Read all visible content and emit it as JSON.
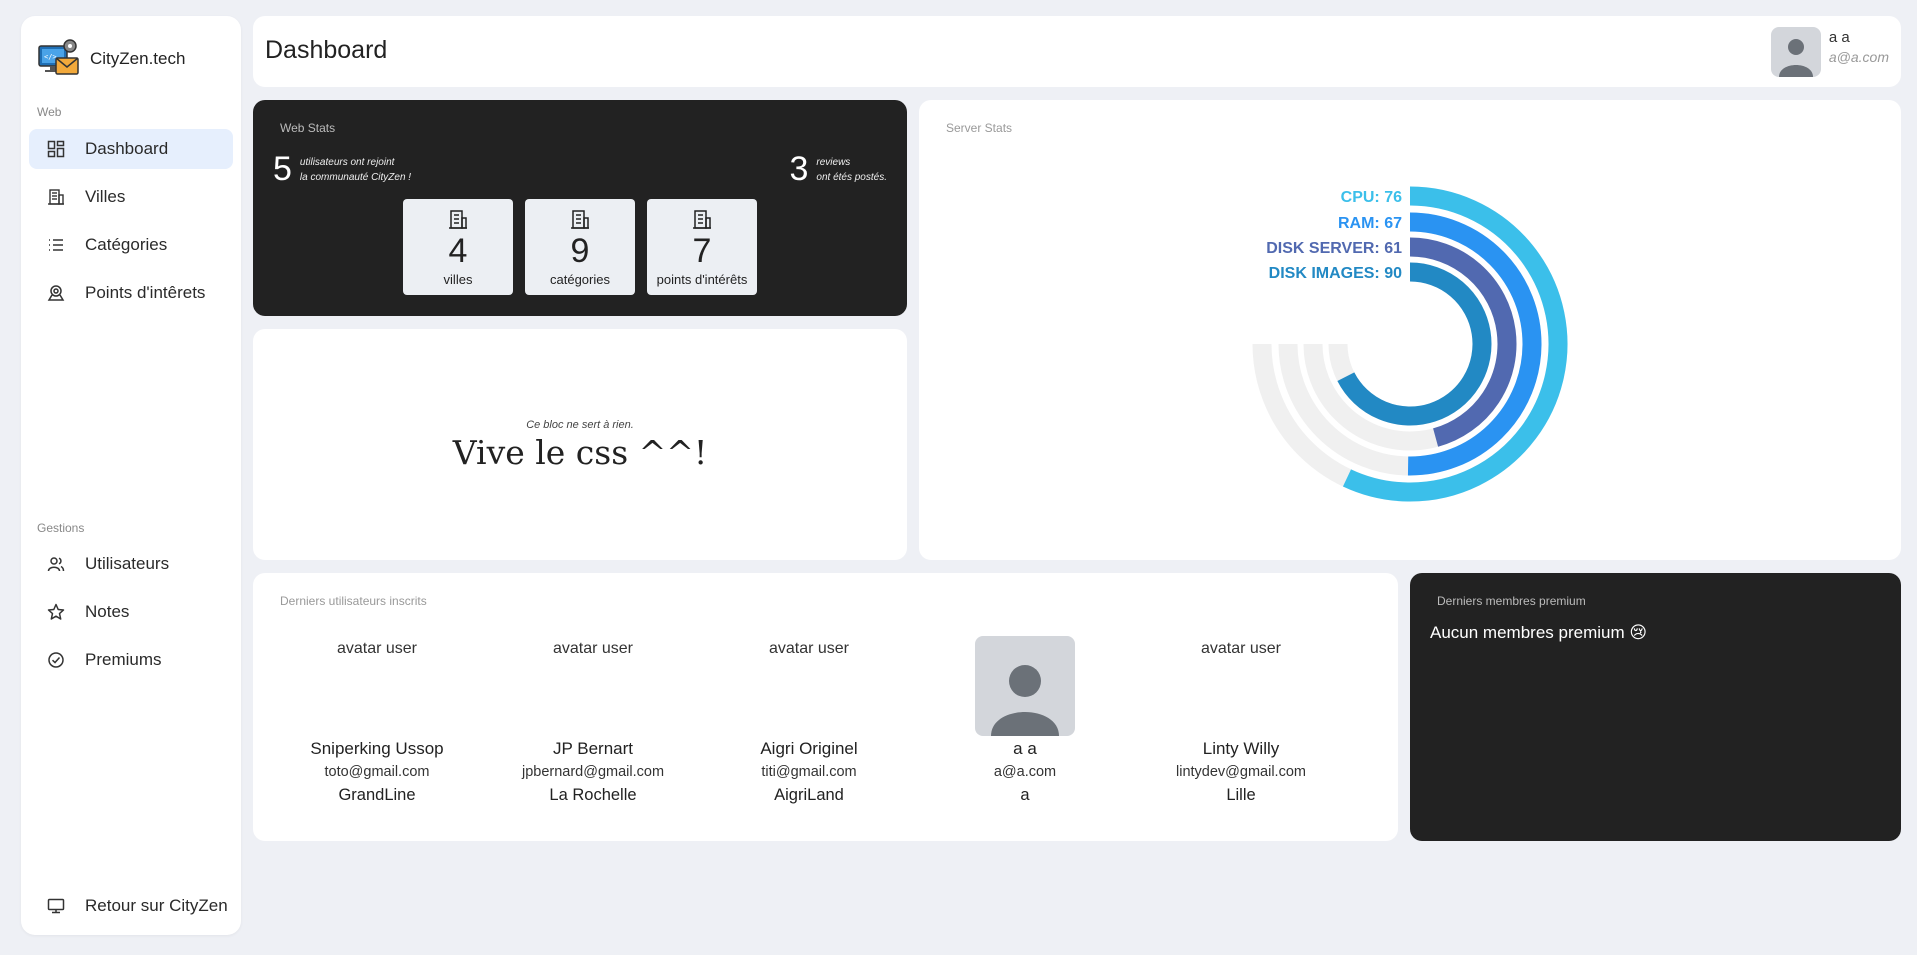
{
  "brand": {
    "name": "CityZen.tech"
  },
  "sidebar": {
    "section_web": "Web",
    "section_gestions": "Gestions",
    "items": [
      {
        "label": "Dashboard",
        "icon": "dashboard-icon"
      },
      {
        "label": "Villes",
        "icon": "building-icon"
      },
      {
        "label": "Catégories",
        "icon": "list-icon"
      },
      {
        "label": "Points d'intêrets",
        "icon": "map-pin-icon"
      },
      {
        "label": "Utilisateurs",
        "icon": "users-icon"
      },
      {
        "label": "Notes",
        "icon": "star-icon"
      },
      {
        "label": "Premiums",
        "icon": "check-circle-icon"
      }
    ],
    "back_label": "Retour sur CityZen"
  },
  "header": {
    "title": "Dashboard",
    "user_name": "a a",
    "user_email": "a@a.com"
  },
  "web_stats": {
    "label": "Web Stats",
    "users_count": "5",
    "users_text_1": "utilisateurs ont rejoint",
    "users_text_2": "la communauté CityZen !",
    "reviews_count": "3",
    "reviews_text_1": "reviews",
    "reviews_text_2": "ont étés postés.",
    "tiles": [
      {
        "value": "4",
        "label": "villes"
      },
      {
        "value": "9",
        "label": "catégories"
      },
      {
        "value": "7",
        "label": "points d'intérêts"
      }
    ]
  },
  "css_block": {
    "small": "Ce bloc ne sert à rien.",
    "big": "Vive le css ^^!"
  },
  "server_stats": {
    "label": "Server Stats"
  },
  "chart_data": {
    "type": "radialBar",
    "title": "",
    "series": [
      {
        "name": "CPU",
        "value": 76,
        "color": "#3bbfea"
      },
      {
        "name": "RAM",
        "value": 67,
        "color": "#2a93f2"
      },
      {
        "name": "DISK SERVER",
        "value": 61,
        "color": "#5169b0"
      },
      {
        "name": "DISK IMAGES",
        "value": 90,
        "color": "#2289c4"
      }
    ],
    "max": 100,
    "track_color": "#f0f0f0"
  },
  "latest_users": {
    "label": "Derniers utilisateurs inscrits",
    "broken_alt": "avatar user",
    "users": [
      {
        "name": "Sniperking Ussop",
        "email": "toto@gmail.com",
        "city": "GrandLine",
        "has_avatar": false
      },
      {
        "name": "JP Bernart",
        "email": "jpbernard@gmail.com",
        "city": "La Rochelle",
        "has_avatar": false
      },
      {
        "name": "Aigri Originel",
        "email": "titi@gmail.com",
        "city": "AigriLand",
        "has_avatar": false
      },
      {
        "name": "a a",
        "email": "a@a.com",
        "city": "a",
        "has_avatar": true
      },
      {
        "name": "Linty Willy",
        "email": "lintydev@gmail.com",
        "city": "Lille",
        "has_avatar": false
      }
    ]
  },
  "premium": {
    "label": "Derniers membres premium",
    "empty_text": "Aucun membres premium 😢"
  }
}
